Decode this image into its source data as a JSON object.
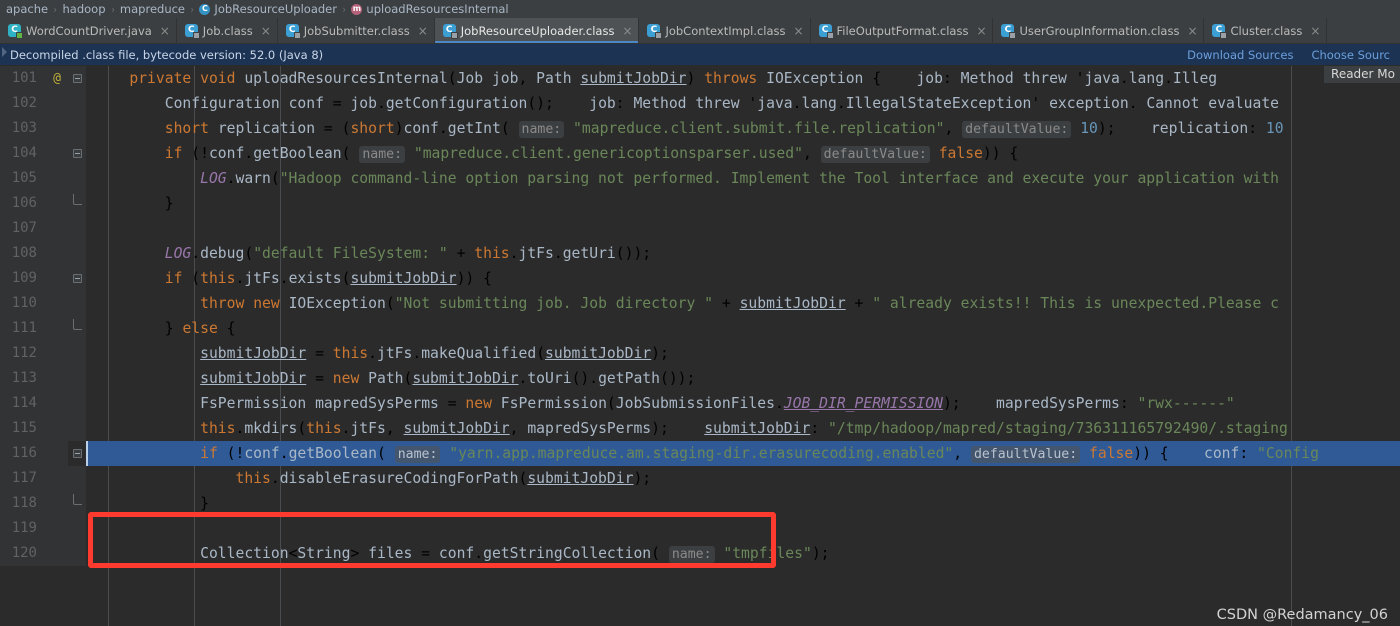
{
  "breadcrumb": {
    "items": [
      {
        "label": "apache",
        "icon": ""
      },
      {
        "label": "hadoop",
        "icon": ""
      },
      {
        "label": "mapreduce",
        "icon": ""
      },
      {
        "label": "JobResourceUploader",
        "icon": "class-icon",
        "icon_glyph": "C"
      },
      {
        "label": "uploadResourcesInternal",
        "icon": "method-icon",
        "icon_glyph": "m"
      }
    ],
    "separator": "›"
  },
  "tabs": [
    {
      "label": "WordCountDriver.java",
      "icon": "java-file-icon",
      "icon_glyph": "C",
      "active": false,
      "close": "×"
    },
    {
      "label": "Job.class",
      "icon": "class-file-icon",
      "icon_glyph": "C",
      "active": false,
      "close": "×"
    },
    {
      "label": "JobSubmitter.class",
      "icon": "class-file-icon",
      "icon_glyph": "C",
      "active": false,
      "close": "×"
    },
    {
      "label": "JobResourceUploader.class",
      "icon": "class-file-icon",
      "icon_glyph": "C",
      "active": true,
      "close": "×"
    },
    {
      "label": "JobContextImpl.class",
      "icon": "class-file-icon",
      "icon_glyph": "C",
      "active": false,
      "close": "×"
    },
    {
      "label": "FileOutputFormat.class",
      "icon": "class-file-icon",
      "icon_glyph": "C",
      "active": false,
      "close": "×"
    },
    {
      "label": "UserGroupInformation.class",
      "icon": "class-file-icon",
      "icon_glyph": "C",
      "active": false,
      "close": "×"
    },
    {
      "label": "Cluster.class",
      "icon": "class-file-icon",
      "icon_glyph": "C",
      "active": false,
      "close": "×"
    }
  ],
  "notice": {
    "text": "Decompiled .class file, bytecode version: 52.0 (Java 8)",
    "download_sources": "Download Sources",
    "choose_sources": "Choose Sourc"
  },
  "reader_mode_label": "Reader Mo",
  "watermark": "CSDN @Redamancy_06",
  "editor": {
    "first_line": 101,
    "selected_line": 116,
    "lines": [
      {
        "n": "101",
        "ann": "@",
        "fold": "box",
        "text": "    private void uploadResourcesInternal(Job job, Path submitJobDir) throws IOException {    job: Method threw 'java.lang.Illeg"
      },
      {
        "n": "102",
        "ann": "",
        "fold": "",
        "text": "        Configuration conf = job.getConfiguration();    job: Method threw 'java.lang.IllegalStateException' exception. Cannot evaluate"
      },
      {
        "n": "103",
        "ann": "",
        "fold": "",
        "text": "        short replication = (short)conf.getInt( name: \"mapreduce.client.submit.file.replication\", defaultValue: 10);    replication: 10"
      },
      {
        "n": "104",
        "ann": "",
        "fold": "box",
        "text": "        if (!conf.getBoolean( name: \"mapreduce.client.genericoptionsparser.used\", defaultValue: false)) {"
      },
      {
        "n": "105",
        "ann": "",
        "fold": "",
        "text": "            LOG.warn(\"Hadoop command-line option parsing not performed. Implement the Tool interface and execute your application with"
      },
      {
        "n": "106",
        "ann": "",
        "fold": "end",
        "text": "        }"
      },
      {
        "n": "107",
        "ann": "",
        "fold": "",
        "text": ""
      },
      {
        "n": "108",
        "ann": "",
        "fold": "",
        "text": "        LOG.debug(\"default FileSystem: \" + this.jtFs.getUri());"
      },
      {
        "n": "109",
        "ann": "",
        "fold": "box",
        "text": "        if (this.jtFs.exists(submitJobDir)) {"
      },
      {
        "n": "110",
        "ann": "",
        "fold": "",
        "text": "            throw new IOException(\"Not submitting job. Job directory \" + submitJobDir + \" already exists!! This is unexpected.Please c"
      },
      {
        "n": "111",
        "ann": "",
        "fold": "end",
        "text": "        } else {"
      },
      {
        "n": "112",
        "ann": "",
        "fold": "",
        "text": "            submitJobDir = this.jtFs.makeQualified(submitJobDir);"
      },
      {
        "n": "113",
        "ann": "",
        "fold": "",
        "text": "            submitJobDir = new Path(submitJobDir.toUri().getPath());"
      },
      {
        "n": "114",
        "ann": "",
        "fold": "",
        "text": "            FsPermission mapredSysPerms = new FsPermission(JobSubmissionFiles.JOB_DIR_PERMISSION);    mapredSysPerms: \"rwx------\""
      },
      {
        "n": "115",
        "ann": "",
        "fold": "",
        "text": "            this.mkdirs(this.jtFs, submitJobDir, mapredSysPerms);    submitJobDir: \"/tmp/hadoop/mapred/staging/736311165792490/.staging"
      },
      {
        "n": "116",
        "ann": "",
        "fold": "box",
        "text": "            if (!conf.getBoolean( name: \"yarn.app.mapreduce.am.staging-dir.erasurecoding.enabled\", defaultValue: false)) {    conf: \"Config"
      },
      {
        "n": "117",
        "ann": "",
        "fold": "",
        "text": "                this.disableErasureCodingForPath(submitJobDir);"
      },
      {
        "n": "118",
        "ann": "",
        "fold": "end",
        "text": "            }"
      },
      {
        "n": "119",
        "ann": "",
        "fold": "",
        "text": ""
      },
      {
        "n": "120",
        "ann": "",
        "fold": "",
        "text": "            Collection<String> files = conf.getStringCollection( name: \"tmpfiles\");"
      }
    ]
  },
  "colors": {
    "editor_bg": "#2b2b2b",
    "gutter_bg": "#313335",
    "tabbar_bg": "#3c3f41",
    "notice_bg": "#1d3354",
    "selection": "#2f5a96",
    "annotation_red": "#ff3a2f",
    "keyword": "#cc7832",
    "string": "#6a8759",
    "number": "#6897bb",
    "static_field": "#9876aa",
    "identifier": "#a9b7c6"
  }
}
